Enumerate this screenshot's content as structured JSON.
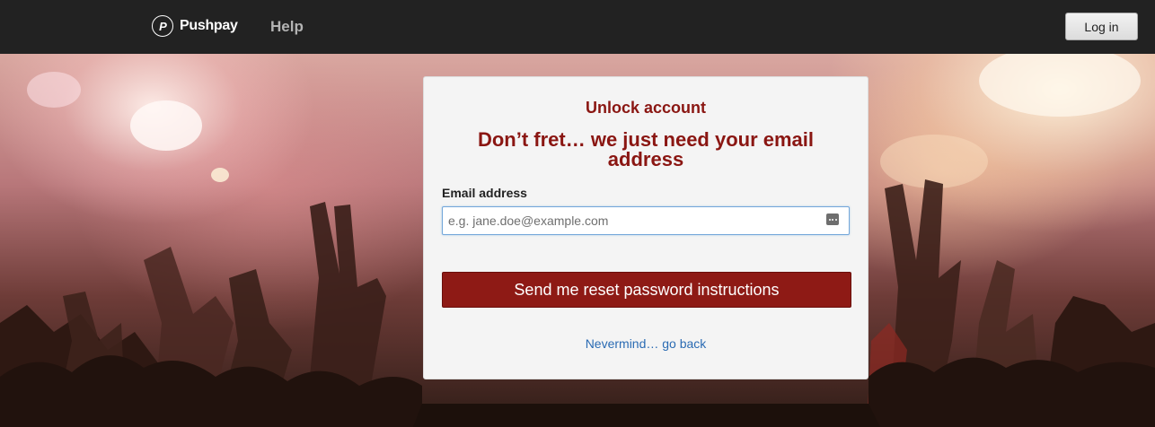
{
  "header": {
    "brand_name": "Pushpay",
    "brand_mark": "P",
    "help_label": "Help",
    "login_label": "Log in"
  },
  "card": {
    "title": "Unlock account",
    "heading": "Don’t fret… we just need your email address",
    "email": {
      "label": "Email address",
      "value": "",
      "placeholder": "e.g. jane.doe@example.com"
    },
    "submit_label": "Send me reset password instructions",
    "back_link": "Nevermind… go back"
  },
  "icons": {
    "logo": "pushpay-logo-icon",
    "autofill": "password-manager-icon"
  },
  "colors": {
    "topbar_bg": "#222222",
    "accent_red": "#8e1a15",
    "heading_red": "#8a1612",
    "link_blue": "#2a6bb3",
    "card_bg": "#f4f4f4"
  }
}
